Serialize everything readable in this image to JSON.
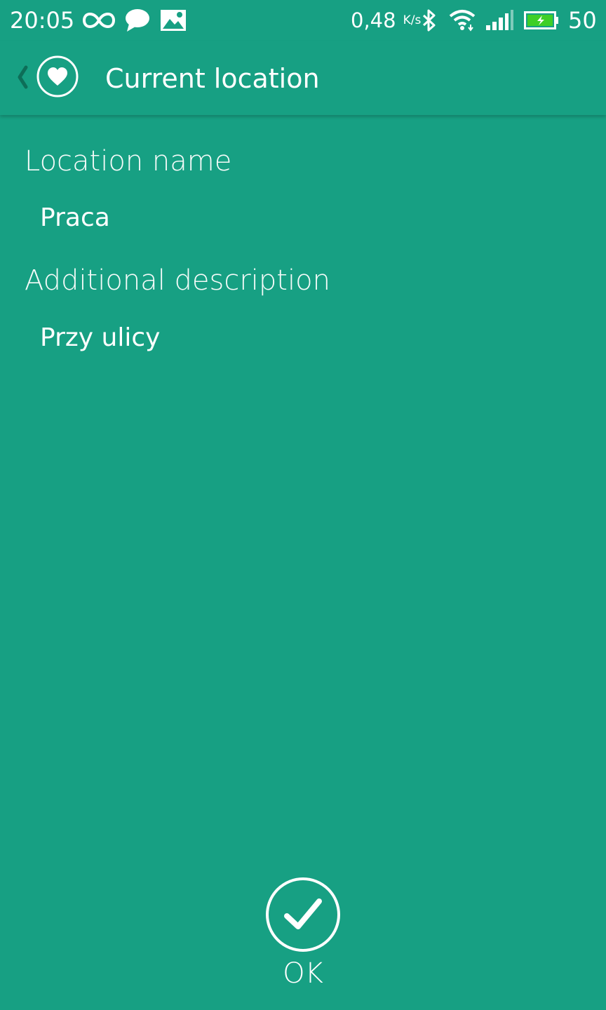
{
  "status_bar": {
    "time": "20:05",
    "net_speed": "0,48",
    "net_speed_unit": "K/s",
    "battery_percent": "50",
    "icons": [
      "infinity-icon",
      "chat-icon",
      "image-icon",
      "bluetooth-icon",
      "wifi-icon",
      "signal-icon",
      "battery-charging-icon"
    ],
    "battery_color": "#3ecf27"
  },
  "app_bar": {
    "title": "Current location",
    "icons": [
      "back-chevron-icon",
      "heart-icon"
    ]
  },
  "form": {
    "location_name_label": "Location name",
    "location_name_value": "Praca",
    "description_label": "Additional description",
    "description_value": "Przy ulicy"
  },
  "actions": {
    "ok_label": "OK"
  },
  "theme": {
    "background": "#17a083",
    "accent_dark": "#0d6e58",
    "foreground": "#ffffff"
  }
}
